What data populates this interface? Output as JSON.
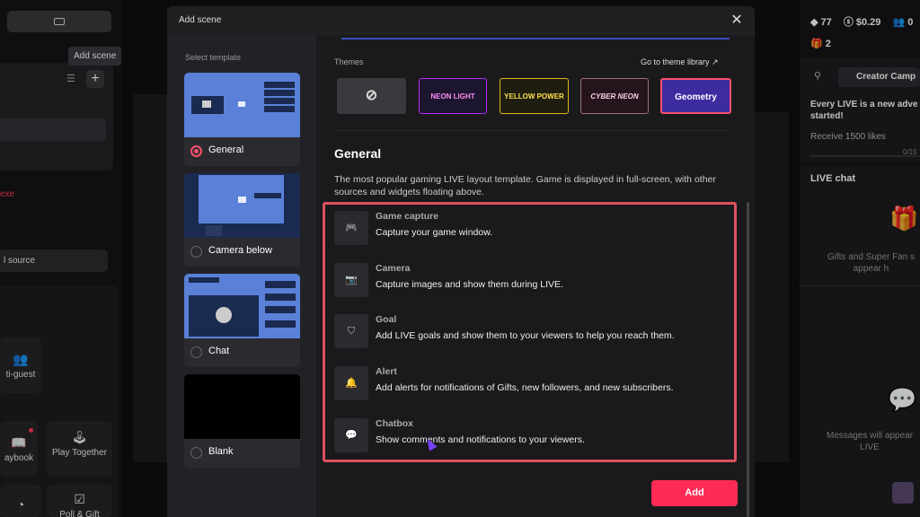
{
  "background": {
    "tooltip": "Add scene",
    "exe_text": "exe",
    "source_button": "l source",
    "tiles": [
      {
        "label": "ti-guest",
        "icon": "users-icon"
      },
      {
        "label": "aybook",
        "icon": "book-icon"
      },
      {
        "label": "Play Together",
        "icon": "joystick-icon"
      },
      {
        "label": "Poll & Gift",
        "icon": "poll-icon"
      }
    ],
    "right": {
      "diamonds": "77",
      "coins": "$0.29",
      "viewers": "0",
      "gifts": "2",
      "creator_button": "Creator Camp",
      "mission_title": "Every LIVE is a new adve started!",
      "mission_task": "Receive 1500 likes",
      "mission_progress": "0/15",
      "live_chat_title": "LIVE chat",
      "gifts_note": "Gifts and Super Fan s appear h",
      "messages_note": "Messages will appear LIVE"
    }
  },
  "modal": {
    "title": "Add scene",
    "select_template_label": "Select template",
    "templates": [
      {
        "label": "General",
        "selected": true
      },
      {
        "label": "Camera below",
        "selected": false
      },
      {
        "label": "Chat",
        "selected": false
      },
      {
        "label": "Blank",
        "selected": false
      }
    ],
    "themes_label": "Themes",
    "theme_library_link": "Go to theme library ↗",
    "themes": [
      {
        "label": "⊘",
        "name": "none"
      },
      {
        "label": "NEON LIGHT",
        "name": "neon-light"
      },
      {
        "label": "YELLOW POWER",
        "name": "yellow-power"
      },
      {
        "label": "CYBER NEON",
        "name": "cyber-neon"
      },
      {
        "label": "Geometry",
        "name": "geometry",
        "selected": true
      }
    ],
    "section_title": "General",
    "section_desc": "The most popular gaming LIVE layout template. Game is displayed in full-screen, with other sources and widgets floating above.",
    "sources": [
      {
        "name": "Game capture",
        "desc": "Capture your game window.",
        "icon": "gamepad-icon"
      },
      {
        "name": "Camera",
        "desc": "Capture images and show them during LIVE.",
        "icon": "camera-icon"
      },
      {
        "name": "Goal",
        "desc": "Add LIVE goals and show them to your viewers to help you reach them.",
        "icon": "shield-icon"
      },
      {
        "name": "Alert",
        "desc": "Add alerts for notifications of Gifts, new followers, and new subscribers.",
        "icon": "bell-icon"
      },
      {
        "name": "Chatbox",
        "desc": "Show comments and notifications to your viewers.",
        "icon": "chat-icon"
      }
    ],
    "add_button": "Add"
  },
  "colors": {
    "accent": "#fe2c55",
    "highlight_box": "#e05060"
  }
}
